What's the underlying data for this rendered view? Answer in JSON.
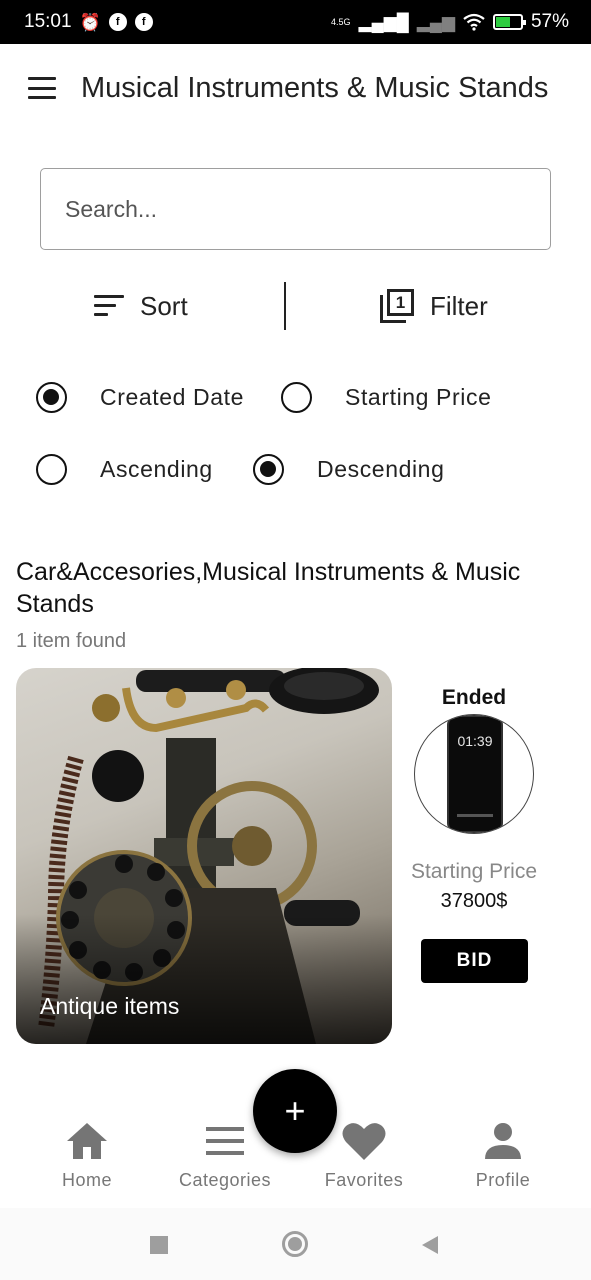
{
  "status_bar": {
    "time": "15:01",
    "network": "4.5G",
    "battery": "57%",
    "battery_level": 0.57
  },
  "app_bar": {
    "title": "Musical Instruments & Music Stands"
  },
  "search": {
    "placeholder": "Search...",
    "value": ""
  },
  "toolbar": {
    "sort_label": "Sort",
    "filter_label": "Filter",
    "filter_count": "1"
  },
  "sort_options": {
    "field": [
      {
        "label": "Created Date",
        "selected": true
      },
      {
        "label": "Starting Price",
        "selected": false
      }
    ],
    "order": [
      {
        "label": "Ascending",
        "selected": false
      },
      {
        "label": "Descending",
        "selected": true
      }
    ]
  },
  "results": {
    "categories": "Car&Accesories,Musical Instruments & Music Stands",
    "count_text": "1 item found",
    "items": [
      {
        "name": "Antique items",
        "status": "Ended",
        "thumb_time": "01:39",
        "price_label": "Starting Price",
        "price": "37800$",
        "action_label": "BID"
      }
    ]
  },
  "fab": {
    "label": "+"
  },
  "bottom_nav": [
    {
      "label": "Home",
      "icon": "home-icon"
    },
    {
      "label": "Categories",
      "icon": "list-icon"
    },
    {
      "label": "Favorites",
      "icon": "heart-icon"
    },
    {
      "label": "Profile",
      "icon": "person-icon"
    }
  ],
  "colors": {
    "primary": "#000000",
    "nav_icon": "#757575",
    "muted_text": "#777777"
  }
}
